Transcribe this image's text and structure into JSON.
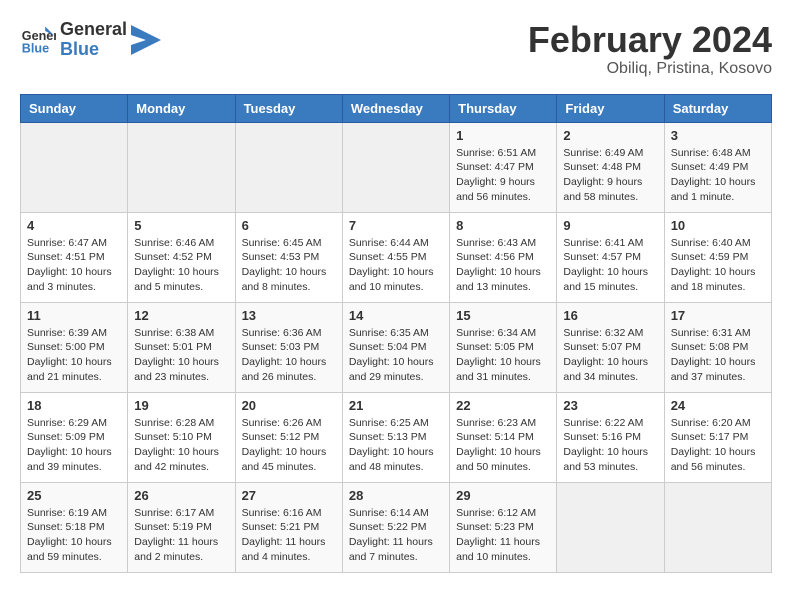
{
  "logo": {
    "text_general": "General",
    "text_blue": "Blue"
  },
  "title": "February 2024",
  "subtitle": "Obiliq, Pristina, Kosovo",
  "days_of_week": [
    "Sunday",
    "Monday",
    "Tuesday",
    "Wednesday",
    "Thursday",
    "Friday",
    "Saturday"
  ],
  "weeks": [
    [
      {
        "day": "",
        "info": ""
      },
      {
        "day": "",
        "info": ""
      },
      {
        "day": "",
        "info": ""
      },
      {
        "day": "",
        "info": ""
      },
      {
        "day": "1",
        "info": "Sunrise: 6:51 AM\nSunset: 4:47 PM\nDaylight: 9 hours\nand 56 minutes."
      },
      {
        "day": "2",
        "info": "Sunrise: 6:49 AM\nSunset: 4:48 PM\nDaylight: 9 hours\nand 58 minutes."
      },
      {
        "day": "3",
        "info": "Sunrise: 6:48 AM\nSunset: 4:49 PM\nDaylight: 10 hours\nand 1 minute."
      }
    ],
    [
      {
        "day": "4",
        "info": "Sunrise: 6:47 AM\nSunset: 4:51 PM\nDaylight: 10 hours\nand 3 minutes."
      },
      {
        "day": "5",
        "info": "Sunrise: 6:46 AM\nSunset: 4:52 PM\nDaylight: 10 hours\nand 5 minutes."
      },
      {
        "day": "6",
        "info": "Sunrise: 6:45 AM\nSunset: 4:53 PM\nDaylight: 10 hours\nand 8 minutes."
      },
      {
        "day": "7",
        "info": "Sunrise: 6:44 AM\nSunset: 4:55 PM\nDaylight: 10 hours\nand 10 minutes."
      },
      {
        "day": "8",
        "info": "Sunrise: 6:43 AM\nSunset: 4:56 PM\nDaylight: 10 hours\nand 13 minutes."
      },
      {
        "day": "9",
        "info": "Sunrise: 6:41 AM\nSunset: 4:57 PM\nDaylight: 10 hours\nand 15 minutes."
      },
      {
        "day": "10",
        "info": "Sunrise: 6:40 AM\nSunset: 4:59 PM\nDaylight: 10 hours\nand 18 minutes."
      }
    ],
    [
      {
        "day": "11",
        "info": "Sunrise: 6:39 AM\nSunset: 5:00 PM\nDaylight: 10 hours\nand 21 minutes."
      },
      {
        "day": "12",
        "info": "Sunrise: 6:38 AM\nSunset: 5:01 PM\nDaylight: 10 hours\nand 23 minutes."
      },
      {
        "day": "13",
        "info": "Sunrise: 6:36 AM\nSunset: 5:03 PM\nDaylight: 10 hours\nand 26 minutes."
      },
      {
        "day": "14",
        "info": "Sunrise: 6:35 AM\nSunset: 5:04 PM\nDaylight: 10 hours\nand 29 minutes."
      },
      {
        "day": "15",
        "info": "Sunrise: 6:34 AM\nSunset: 5:05 PM\nDaylight: 10 hours\nand 31 minutes."
      },
      {
        "day": "16",
        "info": "Sunrise: 6:32 AM\nSunset: 5:07 PM\nDaylight: 10 hours\nand 34 minutes."
      },
      {
        "day": "17",
        "info": "Sunrise: 6:31 AM\nSunset: 5:08 PM\nDaylight: 10 hours\nand 37 minutes."
      }
    ],
    [
      {
        "day": "18",
        "info": "Sunrise: 6:29 AM\nSunset: 5:09 PM\nDaylight: 10 hours\nand 39 minutes."
      },
      {
        "day": "19",
        "info": "Sunrise: 6:28 AM\nSunset: 5:10 PM\nDaylight: 10 hours\nand 42 minutes."
      },
      {
        "day": "20",
        "info": "Sunrise: 6:26 AM\nSunset: 5:12 PM\nDaylight: 10 hours\nand 45 minutes."
      },
      {
        "day": "21",
        "info": "Sunrise: 6:25 AM\nSunset: 5:13 PM\nDaylight: 10 hours\nand 48 minutes."
      },
      {
        "day": "22",
        "info": "Sunrise: 6:23 AM\nSunset: 5:14 PM\nDaylight: 10 hours\nand 50 minutes."
      },
      {
        "day": "23",
        "info": "Sunrise: 6:22 AM\nSunset: 5:16 PM\nDaylight: 10 hours\nand 53 minutes."
      },
      {
        "day": "24",
        "info": "Sunrise: 6:20 AM\nSunset: 5:17 PM\nDaylight: 10 hours\nand 56 minutes."
      }
    ],
    [
      {
        "day": "25",
        "info": "Sunrise: 6:19 AM\nSunset: 5:18 PM\nDaylight: 10 hours\nand 59 minutes."
      },
      {
        "day": "26",
        "info": "Sunrise: 6:17 AM\nSunset: 5:19 PM\nDaylight: 11 hours\nand 2 minutes."
      },
      {
        "day": "27",
        "info": "Sunrise: 6:16 AM\nSunset: 5:21 PM\nDaylight: 11 hours\nand 4 minutes."
      },
      {
        "day": "28",
        "info": "Sunrise: 6:14 AM\nSunset: 5:22 PM\nDaylight: 11 hours\nand 7 minutes."
      },
      {
        "day": "29",
        "info": "Sunrise: 6:12 AM\nSunset: 5:23 PM\nDaylight: 11 hours\nand 10 minutes."
      },
      {
        "day": "",
        "info": ""
      },
      {
        "day": "",
        "info": ""
      }
    ]
  ]
}
